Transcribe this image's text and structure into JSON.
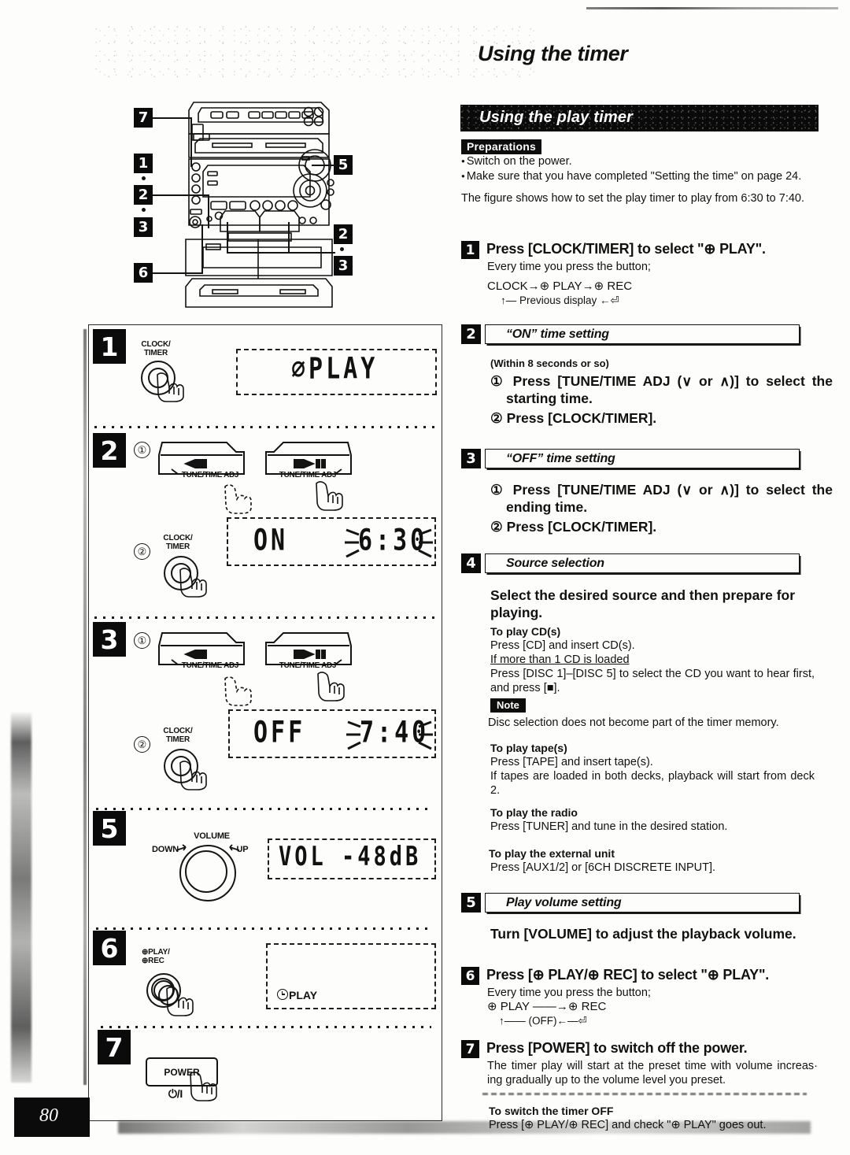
{
  "page": {
    "title": "Using the timer",
    "section_band": "Using the play timer",
    "page_number": "80"
  },
  "preparations": {
    "tag": "Preparations",
    "items": [
      "Switch on the power.",
      "Make sure that you have completed \"Setting the time\" on page 24."
    ]
  },
  "intro": "The figure shows how to set the play timer to play from 6:30 to 7:40.",
  "steps": [
    {
      "num": "1",
      "title": "Press [CLOCK/TIMER] to select \"⊕ PLAY\".",
      "sub": "Every time you press the button;",
      "flow_line1": "CLOCK→⊕ PLAY→⊕ REC",
      "flow_line2": "↑— Previous display ←⏎"
    },
    {
      "num": "2",
      "header": "“ON” time setting",
      "timing": "(Within 8 seconds or so)",
      "item1": "Press [TUNE/TIME ADJ (∨ or ∧)] to select the starting time.",
      "item2": "Press [CLOCK/TIMER]."
    },
    {
      "num": "3",
      "header": "“OFF” time setting",
      "item1": "Press [TUNE/TIME ADJ (∨ or ∧)] to select the ending time.",
      "item2": "Press [CLOCK/TIMER]."
    },
    {
      "num": "4",
      "header": "Source selection",
      "lead": "Select the desired source and then prepare for playing.",
      "groups": [
        {
          "heading": "To play CD(s)",
          "lines": [
            "Press [CD] and insert CD(s)."
          ],
          "underlined": "If more than 1 CD is loaded",
          "after": "Press [DISC 1]–[DISC 5] to select the CD you want to hear first, and press [■]."
        },
        {
          "heading": "To play tape(s)",
          "lines": [
            "Press [TAPE] and insert tape(s).",
            "If tapes are loaded in both decks, playback will start from deck 2."
          ]
        },
        {
          "heading": "To play the radio",
          "lines": [
            "Press [TUNER] and tune in the desired station."
          ]
        },
        {
          "heading": "To play the external unit",
          "lines": [
            "Press [AUX1/2] or [6CH DISCRETE INPUT]."
          ]
        }
      ],
      "note_tag": "Note",
      "note_text": "Disc selection does not become part of the timer memory."
    },
    {
      "num": "5",
      "header": "Play volume setting",
      "lead": "Turn [VOLUME] to adjust the playback volume."
    },
    {
      "num": "6",
      "title": "Press [⊕ PLAY/⊕ REC] to select \"⊕ PLAY\".",
      "sub": "Every time you press the button;",
      "flow_line1": "⊕ PLAY ——→⊕ REC",
      "flow_line2": "↑—— (OFF)←—⏎"
    },
    {
      "num": "7",
      "title": "Press [POWER] to switch off the power.",
      "sub": "The timer play will start at the preset time with volume increas· ing gradually up to the volume level you preset."
    }
  ],
  "footer": {
    "heading": "To switch the timer OFF",
    "text": "Press [⊕ PLAY/⊕ REC] and check \"⊕ PLAY\" goes out."
  },
  "figure": {
    "unit_callouts": [
      "7",
      "1",
      "2",
      "3",
      "5",
      "2",
      "3",
      "6"
    ],
    "panels": [
      {
        "num": "1",
        "button_label": "CLOCK/\nTIMER",
        "display": "⌀PLAY"
      },
      {
        "num": "2",
        "marker1": "①",
        "marker2": "②",
        "key_left": "TUNE/TIME ADJ",
        "key_right": "TUNE/TIME ADJ",
        "button_label": "CLOCK/\nTIMER",
        "display_left": "ON",
        "display_right": "6:30"
      },
      {
        "num": "3",
        "marker1": "①",
        "marker2": "②",
        "key_left": "TUNE/TIME ADJ",
        "key_right": "TUNE/TIME ADJ",
        "button_label": "CLOCK/\nTIMER",
        "display_left": "OFF",
        "display_right": "7:40"
      },
      {
        "num": "5",
        "knob_title": "VOLUME",
        "knob_left": "DOWN",
        "knob_right": "UP",
        "display_left": "VOL",
        "display_right": "-48dB"
      },
      {
        "num": "6",
        "button_label": "⊕PLAY/\n⊕REC",
        "display": "PLAY"
      },
      {
        "num": "7",
        "button_label": "POWER",
        "power_symbol": "⏻/I"
      }
    ]
  },
  "colors": {
    "ink": "#111111",
    "paper": "#fdfdfb",
    "band": "#0a0a0a"
  }
}
